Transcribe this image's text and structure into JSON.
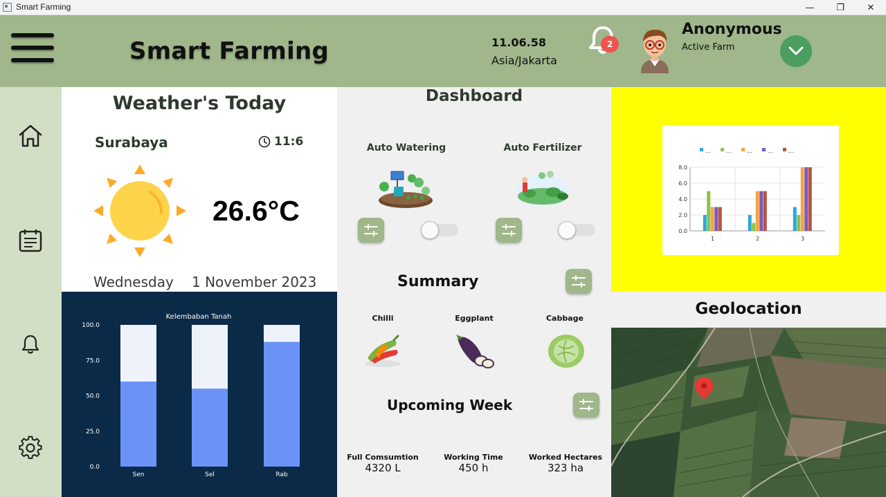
{
  "window": {
    "title": "Smart Farming",
    "minimize": "—",
    "maximize": "❐",
    "close": "✕"
  },
  "header": {
    "app_title": "Smart Farming",
    "clock_time": "11.06.58",
    "clock_zone": "Asia/Jakarta",
    "notification_count": "2",
    "user_name": "Anonymous",
    "user_status": "Active Farm"
  },
  "sidebar": {
    "items": [
      {
        "icon": "home-icon"
      },
      {
        "icon": "calendar-icon"
      },
      {
        "icon": "bell-icon"
      },
      {
        "icon": "gear-icon"
      }
    ]
  },
  "weather": {
    "title": "Weather's Today",
    "city": "Surabaya",
    "time": "11:6",
    "temperature": "26.6°C",
    "day": "Wednesday",
    "date": "1 November 2023"
  },
  "dashboard": {
    "title": "Dashboard",
    "auto_watering": "Auto Watering",
    "auto_fertilizer": "Auto Fertilizer",
    "summary_title": "Summary",
    "vegetables": [
      "Chilli",
      "Eggplant",
      "Cabbage"
    ],
    "upcoming_title": "Upcoming Week",
    "stats": [
      {
        "label": "Full Comsumtion",
        "value": "4320 L"
      },
      {
        "label": "Working Time",
        "value": "450 h"
      },
      {
        "label": "Worked Hectares",
        "value": "323 ha"
      }
    ]
  },
  "geolocation": {
    "title": "Geolocation"
  },
  "colors": {
    "header": "#9fb78a",
    "sidebar": "#d2dfc4",
    "soil_bg": "#0b2a48",
    "bar_fill": "#6b93f7",
    "bar_empty": "#eef3fb",
    "accent_green": "#4b9e5f"
  },
  "chart_data": [
    {
      "type": "bar",
      "title": "Kelembaban Tanah",
      "categories": [
        "Sen",
        "Sel",
        "Rab"
      ],
      "values": [
        60,
        55,
        88
      ],
      "ylim": [
        0,
        100
      ],
      "yticks": [
        "0.0",
        "25.0",
        "50.0",
        "75.0",
        "100.0"
      ]
    },
    {
      "type": "bar",
      "categories": [
        "1",
        "2",
        "3"
      ],
      "legend": [
        "...",
        "...",
        "...",
        "...",
        "..."
      ],
      "series_colors": [
        "#2aa7dd",
        "#8bc34a",
        "#f4a53a",
        "#7e57c2",
        "#b5533c"
      ],
      "series": [
        {
          "values": [
            2,
            2,
            3
          ]
        },
        {
          "values": [
            5,
            1,
            2
          ]
        },
        {
          "values": [
            3,
            5,
            8
          ]
        },
        {
          "values": [
            3,
            5,
            8
          ]
        },
        {
          "values": [
            3,
            5,
            8
          ]
        }
      ],
      "ylim": [
        0,
        8
      ],
      "yticks": [
        "0.0",
        "2.0",
        "4.0",
        "6.0",
        "8.0"
      ]
    }
  ]
}
